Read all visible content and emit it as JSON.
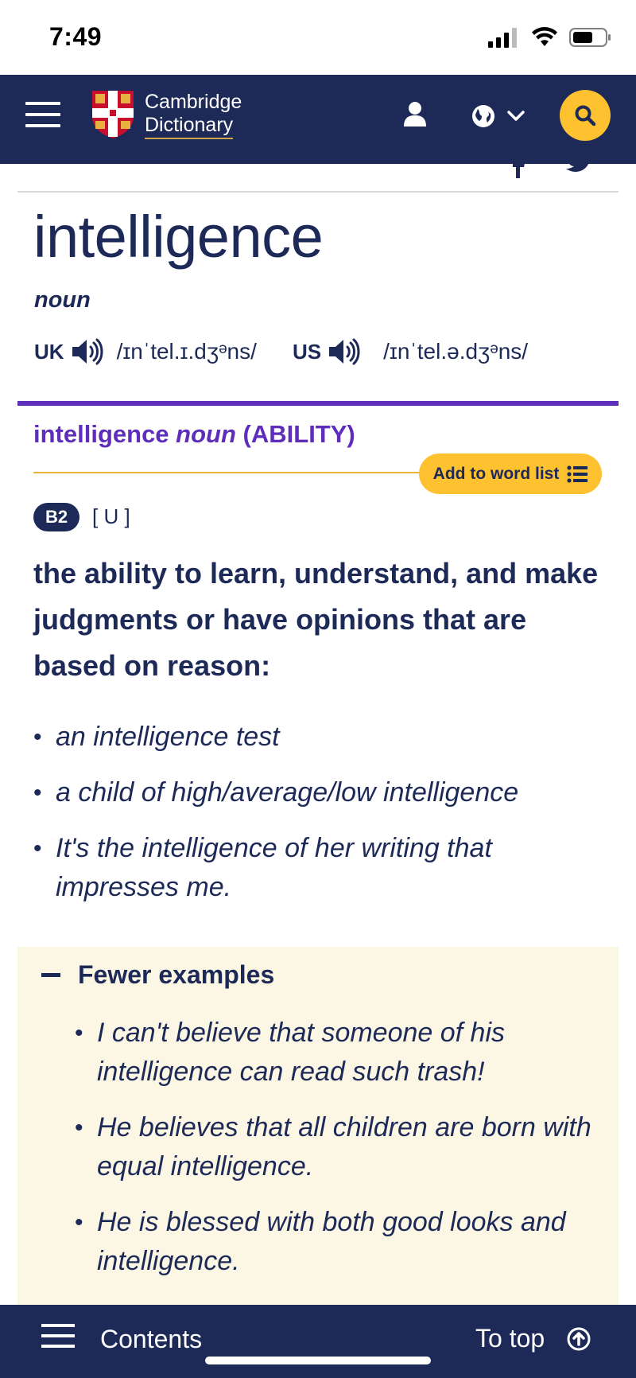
{
  "status_bar": {
    "time": "7:49"
  },
  "header": {
    "logo_line1": "Cambridge",
    "logo_line2": "Dictionary",
    "icons": [
      "menu-icon",
      "cambridge-shield-logo",
      "user-icon",
      "globe-icon",
      "chevron-down-icon",
      "search-icon"
    ],
    "brand_color": "#1d2a57",
    "accent_color": "#fec130"
  },
  "entry": {
    "headword": "intelligence",
    "pos": "noun",
    "pron": {
      "uk_label": "UK",
      "uk_ipa": "/ɪnˈtel.ɪ.dʒᵊns/",
      "us_label": "US",
      "us_ipa": "/ɪnˈtel.ə.dʒᵊns/"
    }
  },
  "sense": {
    "guideword_word": "intelligence",
    "guideword_pos": "noun",
    "guideword_label": "(ABILITY)",
    "guideword_color": "#5e2dba",
    "add_to_list_label": "Add to word list",
    "level": "B2",
    "grammar": "[ U ]",
    "definition": "the ability to learn, understand, and make judgments or have opinions that are based on reason:",
    "examples": [
      "an intelligence test",
      "a child of high/average/low intelligence",
      "It's the intelligence of her writing that impresses me."
    ]
  },
  "more_examples": {
    "toggle_label": "Fewer examples",
    "items": [
      "I can't believe that someone of his intelligence can read such trash!",
      "He believes that all children are born with equal intelligence.",
      "He is blessed with both good looks and intelligence."
    ]
  },
  "bottom_bar": {
    "contents_label": "Contents",
    "to_top_label": "To top"
  }
}
